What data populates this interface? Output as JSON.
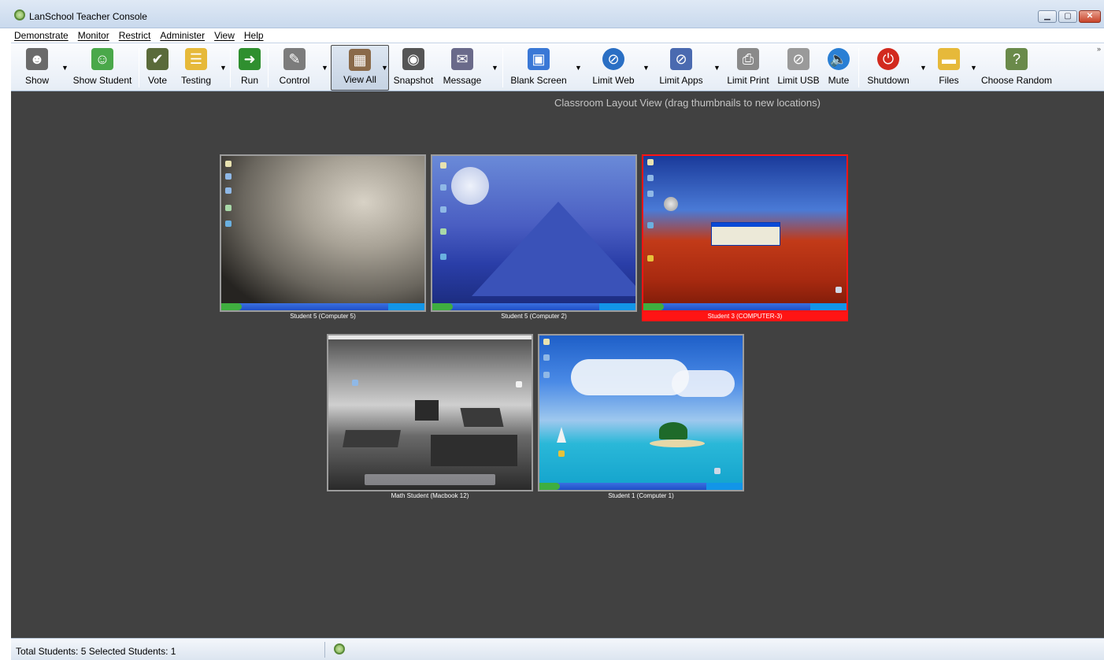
{
  "window": {
    "title": "LanSchool Teacher Console",
    "controls": [
      "minimize",
      "maximize",
      "close"
    ]
  },
  "menu": [
    {
      "label": "Demonstrate"
    },
    {
      "label": "Monitor"
    },
    {
      "label": "Restrict"
    },
    {
      "label": "Administer"
    },
    {
      "label": "View"
    },
    {
      "label": "Help"
    }
  ],
  "toolbar": {
    "show": "Show",
    "show_student": "Show Student",
    "vote": "Vote",
    "testing": "Testing",
    "run": "Run",
    "control": "Control",
    "view_all": "View All",
    "snapshot": "Snapshot",
    "message": "Message",
    "blank_screen": "Blank Screen",
    "limit_web": "Limit Web",
    "limit_apps": "Limit Apps",
    "limit_print": "Limit Print",
    "limit_usb": "Limit USB",
    "mute": "Mute",
    "shutdown": "Shutdown",
    "files": "Files",
    "choose_random": "Choose Random",
    "overflow": "»"
  },
  "layout_title": "Classroom Layout View (drag thumbnails to new locations)",
  "students": [
    {
      "name": "Student 5 (Computer 5)",
      "wallpaper": "moon",
      "selected": false
    },
    {
      "name": "Student 5 (Computer 2)",
      "wallpaper": "blue-mountain",
      "selected": false
    },
    {
      "name": "Student 3 (COMPUTER-3)",
      "wallpaper": "red-desert",
      "selected": true
    },
    {
      "name": "Math Student (Macbook 12)",
      "wallpaper": "bw-rocks",
      "selected": false
    },
    {
      "name": "Student 1 (Computer 1)",
      "wallpaper": "tropical-island",
      "selected": false
    }
  ],
  "status": {
    "text": "Total Students: 5  Selected Students: 1"
  },
  "colors": {
    "selection": "#ff1414",
    "canvas": "#414141"
  }
}
